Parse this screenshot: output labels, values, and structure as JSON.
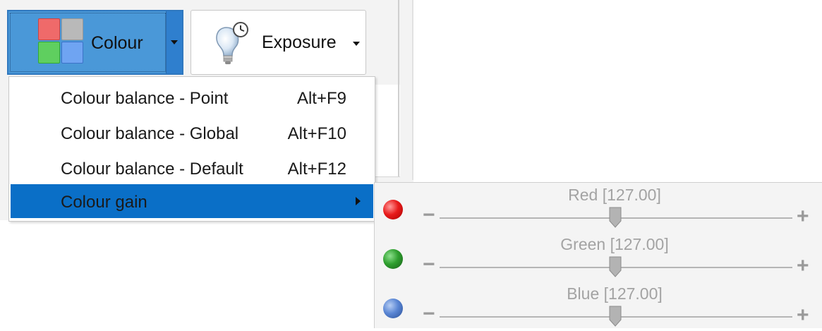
{
  "toolbar": {
    "colour_button": {
      "label": "Colour"
    },
    "exposure_button": {
      "label": "Exposure"
    }
  },
  "colour_menu": {
    "items": [
      {
        "label": "Colour balance - Point",
        "shortcut": "Alt+F9"
      },
      {
        "label": "Colour balance - Global",
        "shortcut": "Alt+F10"
      },
      {
        "label": "Colour balance - Default",
        "shortcut": "Alt+F12"
      },
      {
        "label": "Colour gain",
        "shortcut": ""
      }
    ],
    "highlighted_index": 3
  },
  "colour_gain": {
    "sliders": [
      {
        "label": "Red [127.00]",
        "value": 127.0,
        "min": 0,
        "max": 255,
        "color": "#e81c1c"
      },
      {
        "label": "Green [127.00]",
        "value": 127.0,
        "min": 0,
        "max": 255,
        "color": "#2f9f2f"
      },
      {
        "label": "Blue [127.00]",
        "value": 127.0,
        "min": 0,
        "max": 255,
        "color": "#5a86d4"
      }
    ],
    "minus_symbol": "−",
    "plus_symbol": "+"
  },
  "colors": {
    "accent": "#0a6fc7",
    "button_active": "#4a98d8"
  }
}
